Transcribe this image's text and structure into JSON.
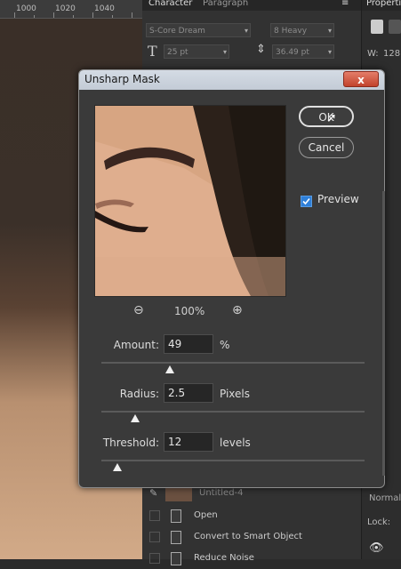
{
  "ruler": {
    "ticks": [
      "1000",
      "1020",
      "1040"
    ]
  },
  "character_panel": {
    "tabs": [
      "Character",
      "Paragraph"
    ],
    "font_family": "S-Core Dream",
    "font_weight": "8 Heavy",
    "font_size": "25 pt",
    "leading": "36.49 pt"
  },
  "properties_panel": {
    "tab": "Properties",
    "w_label": "W:",
    "w_value": "128",
    "layer_mode": "Normal",
    "lock_label": "Lock:"
  },
  "history": {
    "items": [
      "Untitled-4",
      "Open",
      "Convert to Smart Object",
      "Reduce Noise"
    ]
  },
  "dialog": {
    "title": "Unsharp Mask",
    "close_label": "x",
    "ok_label": "OK",
    "cancel_label": "Cancel",
    "preview_label": "Preview",
    "preview_checked": true,
    "zoom_value": "100%",
    "amount": {
      "label": "Amount:",
      "value": "49",
      "unit": "%",
      "slider_fraction": 0.26
    },
    "radius": {
      "label": "Radius:",
      "value": "2.5",
      "unit": "Pixels",
      "slider_fraction": 0.13
    },
    "threshold": {
      "label": "Threshold:",
      "value": "12",
      "unit": "levels",
      "slider_fraction": 0.06
    }
  }
}
